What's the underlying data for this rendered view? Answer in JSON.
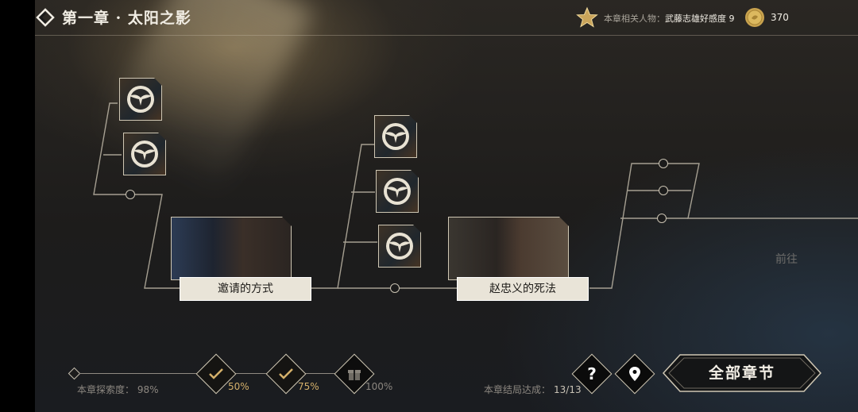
{
  "header": {
    "chapter_title": "第一章 · 太阳之影",
    "related_label": "本章相关人物：",
    "related_value": "武藤志雄好感度 9",
    "coin_count": "370"
  },
  "scenes": [
    {
      "label": "邀请的方式"
    },
    {
      "label": "赵忠义的死法"
    }
  ],
  "goto_text": "前往",
  "progress": {
    "explore_label": "本章探索度：",
    "explore_value": "98%",
    "value": 0.98,
    "milestones": [
      {
        "label": "50%",
        "status": "done"
      },
      {
        "label": "75%",
        "status": "done"
      },
      {
        "label": "100%",
        "status": "locked"
      }
    ]
  },
  "ending": {
    "label": "本章结局达成：",
    "value": "13/13"
  },
  "buttons": {
    "help_icon": "question-icon",
    "location_icon": "map-pin-icon",
    "all_chapters_label": "全部章节"
  },
  "colors": {
    "accent_gold": "#d4b06a",
    "panel_cream": "#e9e4d8"
  }
}
